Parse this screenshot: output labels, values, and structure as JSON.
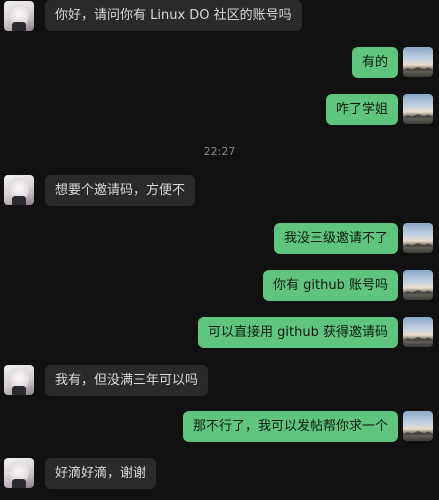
{
  "messages": [
    {
      "side": "left",
      "text": "你好，请问你有 Linux DO 社区的账号吗"
    },
    {
      "side": "right",
      "text": "有的"
    },
    {
      "side": "right",
      "text": "咋了学姐"
    },
    {
      "side": "left",
      "text": "想要个邀请码，方便不"
    },
    {
      "side": "right",
      "text": "我没三级邀请不了"
    },
    {
      "side": "right",
      "text": "你有 github 账号吗"
    },
    {
      "side": "right",
      "text": "可以直接用 github 获得邀请码"
    },
    {
      "side": "left",
      "text": "我有，但没满三年可以吗"
    },
    {
      "side": "right",
      "text": "那不行了，我可以发帖帮你求一个"
    },
    {
      "side": "left",
      "text": "好滴好滴，谢谢"
    }
  ],
  "timestamp": "22:27",
  "colors": {
    "background": "#111111",
    "left_bubble": "#2a2a2a",
    "right_bubble": "#5fc57e"
  },
  "icons": {
    "left_avatar": "anime-girl-avatar",
    "right_avatar": "sky-landscape-avatar"
  }
}
